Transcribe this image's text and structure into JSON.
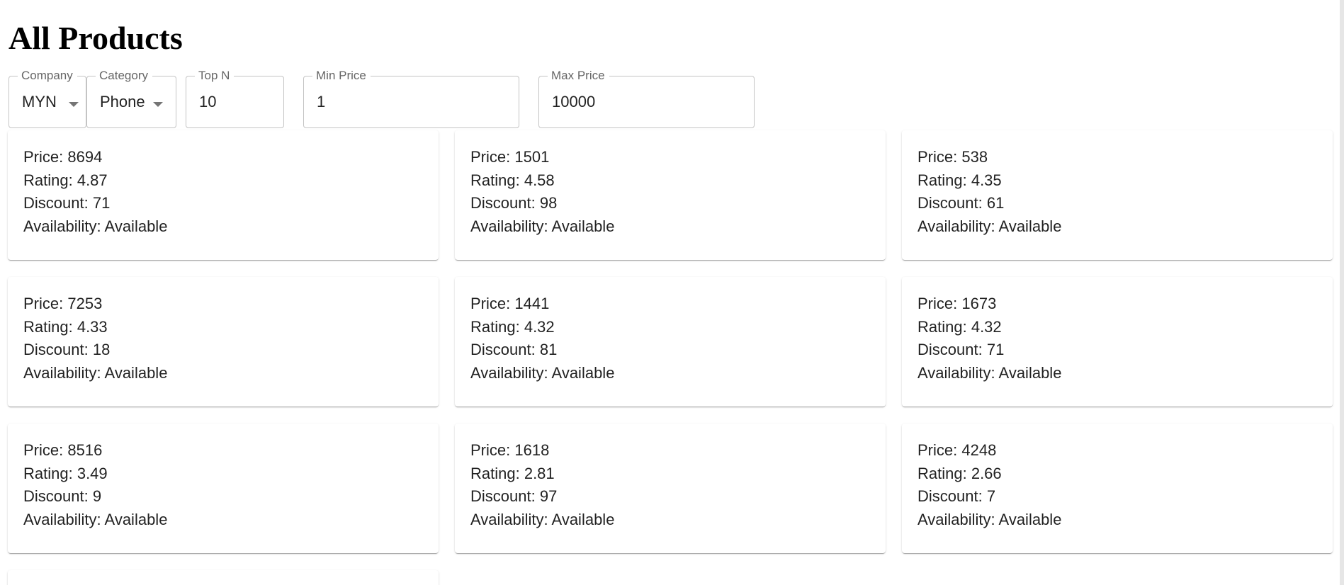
{
  "page": {
    "title": "All Products"
  },
  "filters": {
    "company": {
      "label": "Company",
      "value": "MYN"
    },
    "category": {
      "label": "Category",
      "value": "Phone"
    },
    "top_n": {
      "label": "Top N",
      "value": "10"
    },
    "min_price": {
      "label": "Min Price",
      "value": "1"
    },
    "max_price": {
      "label": "Max Price",
      "value": "10000"
    }
  },
  "labels": {
    "price": "Price: ",
    "rating": "Rating: ",
    "discount": "Discount: ",
    "availability": "Availability: "
  },
  "products": [
    {
      "price": "8694",
      "rating": "4.87",
      "discount": "71",
      "availability": "Available"
    },
    {
      "price": "1501",
      "rating": "4.58",
      "discount": "98",
      "availability": "Available"
    },
    {
      "price": "538",
      "rating": "4.35",
      "discount": "61",
      "availability": "Available"
    },
    {
      "price": "7253",
      "rating": "4.33",
      "discount": "18",
      "availability": "Available"
    },
    {
      "price": "1441",
      "rating": "4.32",
      "discount": "81",
      "availability": "Available"
    },
    {
      "price": "1673",
      "rating": "4.32",
      "discount": "71",
      "availability": "Available"
    },
    {
      "price": "8516",
      "rating": "3.49",
      "discount": "9",
      "availability": "Available"
    },
    {
      "price": "1618",
      "rating": "2.81",
      "discount": "97",
      "availability": "Available"
    },
    {
      "price": "4248",
      "rating": "2.66",
      "discount": "7",
      "availability": "Available"
    }
  ]
}
